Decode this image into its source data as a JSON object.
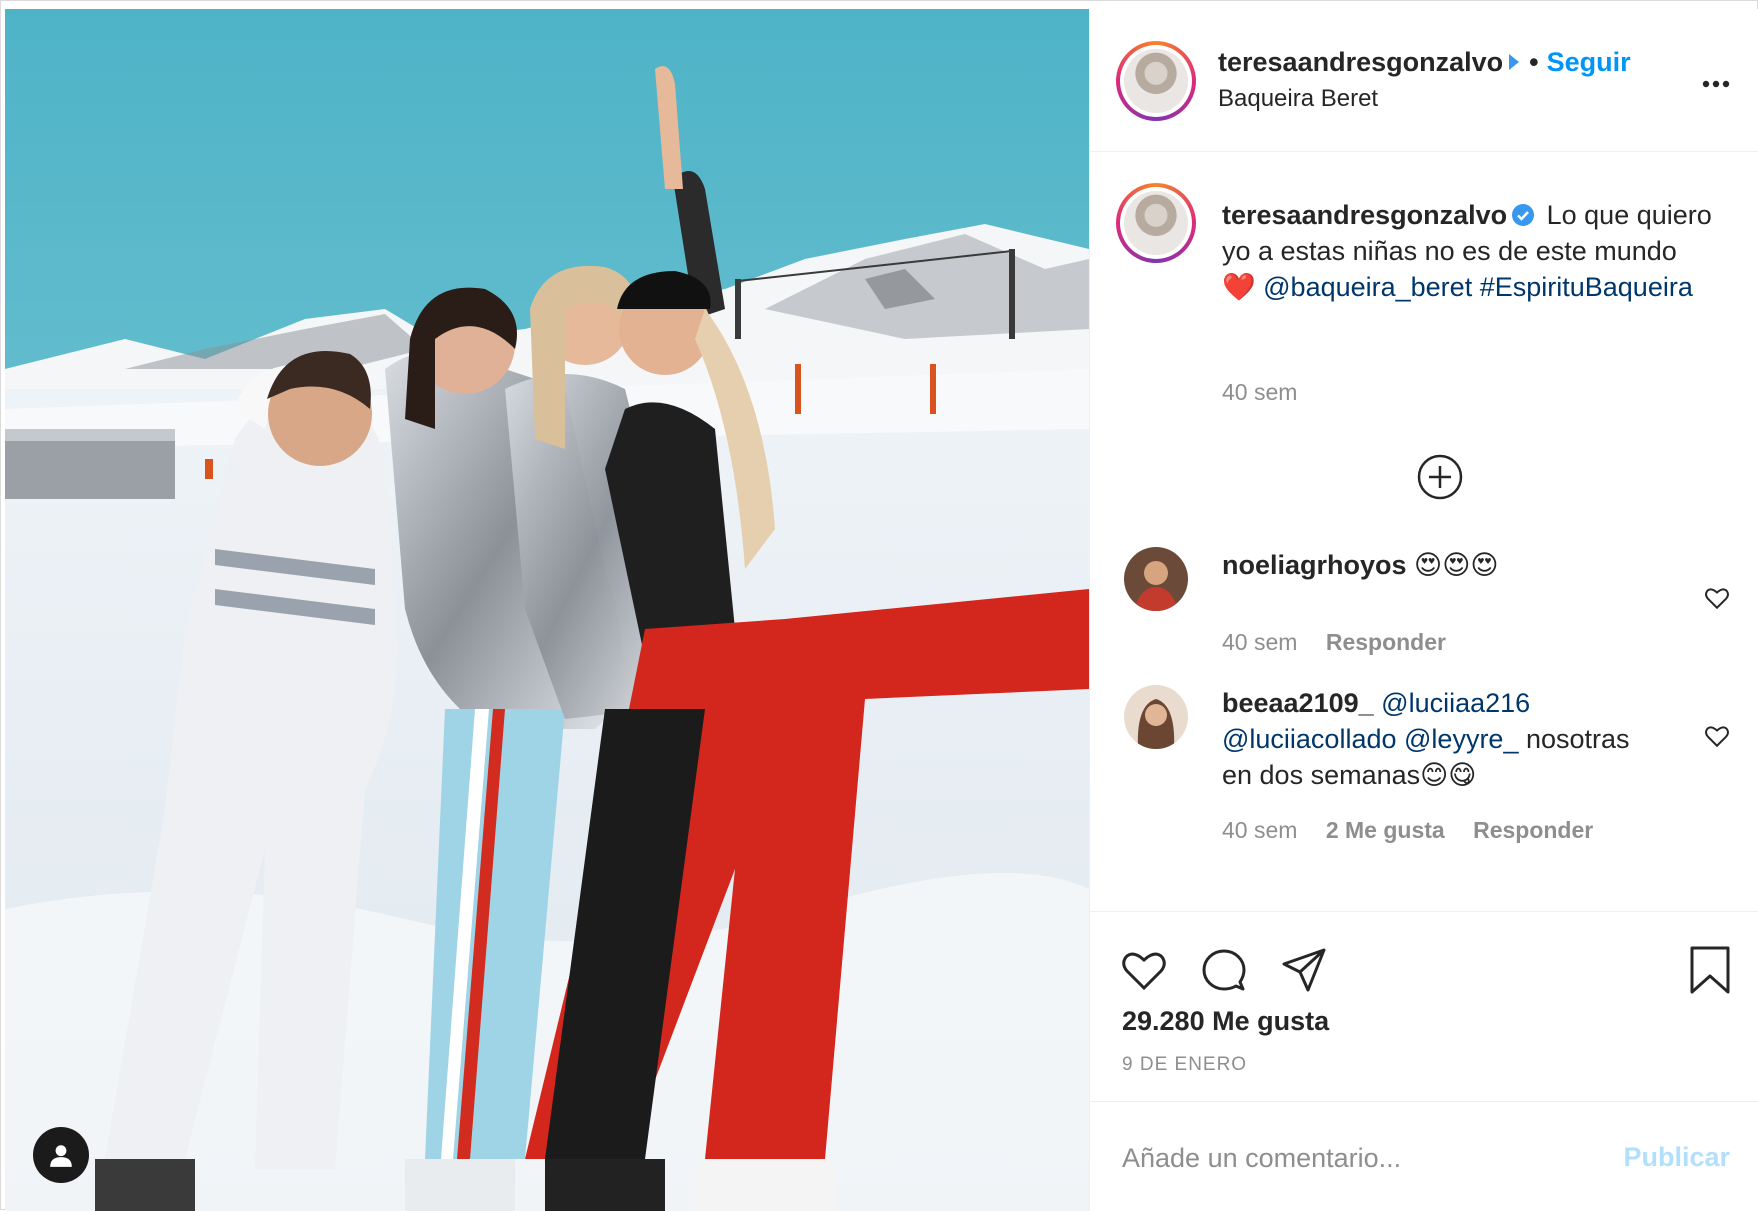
{
  "colors": {
    "accent": "#0095f6",
    "link": "#00376b",
    "secondary_text": "#8e8e8e",
    "publish_disabled": "#b2dffc"
  },
  "header": {
    "username": "teresaandresgonzalvo",
    "follow_label": "Seguir",
    "location": "Baqueira Beret",
    "more_icon": "more-icon"
  },
  "caption": {
    "username": "teresaandresgonzalvo",
    "text_part1": "Lo que quiero yo a estas niñas no es de este mundo",
    "emoji": "❤️",
    "mention": "@baqueira_beret",
    "hashtag": "#EspirituBaqueira",
    "time": "40 sem"
  },
  "comments": [
    {
      "username": "noeliagrhoyos",
      "text": "😍😍😍",
      "time": "40 sem",
      "reply_label": "Responder"
    },
    {
      "username": "beeaa2109_",
      "mention1": "@luciiaa216",
      "mention2": "@luciiacollado",
      "mention3": "@leyyre_",
      "text": "nosotras en dos semanas😊😋",
      "time": "40 sem",
      "likes_label": "2 Me gusta",
      "reply_label": "Responder"
    }
  ],
  "post": {
    "likes": "29.280 Me gusta",
    "date": "9 DE ENERO"
  },
  "comment_box": {
    "placeholder": "Añade un comentario...",
    "publish_label": "Publicar"
  },
  "icons": {
    "like": "heart-icon",
    "comment": "comment-icon",
    "share": "share-icon",
    "save": "bookmark-icon",
    "load_more": "plus-circle-icon",
    "tagged_users": "user-icon"
  }
}
